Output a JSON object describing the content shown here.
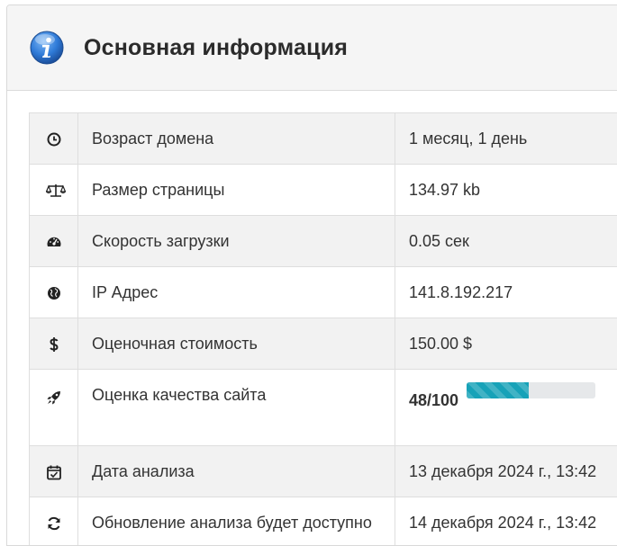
{
  "panel": {
    "title": "Основная информация",
    "header_icon": "info-icon"
  },
  "rows": [
    {
      "icon": "clock-icon",
      "label": "Возраст домена",
      "value": "1 месяц, 1 день"
    },
    {
      "icon": "balance-scale-icon",
      "label": "Размер страницы",
      "value": "134.97 kb"
    },
    {
      "icon": "speedometer-icon",
      "label": "Скорость загрузки",
      "value": "0.05 сек"
    },
    {
      "icon": "globe-icon",
      "label": "IP Адрес",
      "value": "141.8.192.217"
    },
    {
      "icon": "dollar-icon",
      "label": "Оценочная стоимость",
      "value": "150.00 $"
    },
    {
      "icon": "rocket-icon",
      "label": "Оценка качества сайта",
      "value": "48/100",
      "progress": 0.48
    },
    {
      "icon": "calendar-check-icon",
      "label": "Дата анализа",
      "value": "13 декабря 2024 г., 13:42"
    },
    {
      "icon": "refresh-icon",
      "label": "Обновление анализа будет доступно",
      "value": "14 декабря 2024 г., 13:42"
    }
  ],
  "colors": {
    "progress_fill": "#17a2b8",
    "progress_track": "#e6e8ea",
    "info_icon": "#2f7bd8"
  }
}
